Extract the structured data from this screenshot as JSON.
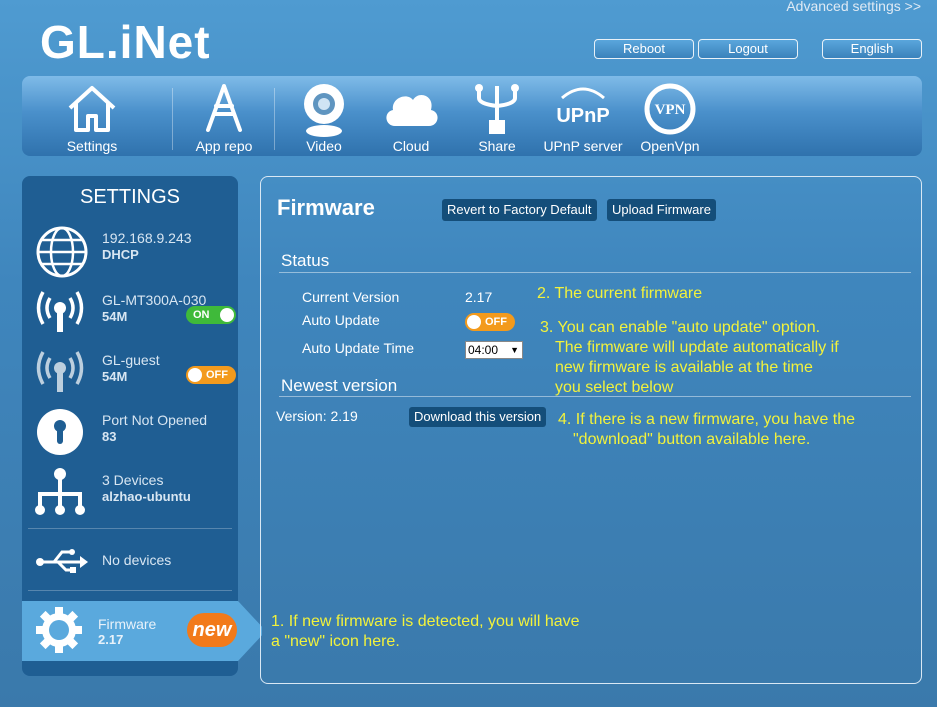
{
  "header": {
    "logo": "GL.iNet",
    "advanced_link": "Advanced settings >>",
    "reboot": "Reboot",
    "logout": "Logout",
    "language": "English"
  },
  "toolbar": {
    "items": [
      {
        "label": "Settings",
        "icon": "house-icon"
      },
      {
        "label": "App repo",
        "icon": "app-repo-icon"
      },
      {
        "label": "Video",
        "icon": "webcam-icon"
      },
      {
        "label": "Cloud",
        "icon": "cloud-icon"
      },
      {
        "label": "Share",
        "icon": "usb-share-icon"
      },
      {
        "label": "UPnP server",
        "icon": "upnp-icon"
      },
      {
        "label": "OpenVpn",
        "icon": "vpn-icon"
      }
    ]
  },
  "sidebar": {
    "title": "SETTINGS",
    "wan": {
      "line1": "192.168.9.243",
      "line2": "DHCP"
    },
    "wifi": {
      "line1": "GL-MT300A-030",
      "line2": "54M",
      "toggle": "ON"
    },
    "guest": {
      "line1": "GL-guest",
      "line2": "54M",
      "toggle": "OFF"
    },
    "port": {
      "line1": "Port Not Opened",
      "line2": "83"
    },
    "devices": {
      "line1": "3 Devices",
      "line2": "alzhao-ubuntu"
    },
    "usb": {
      "line1": "No devices"
    },
    "firmware": {
      "line1": "Firmware",
      "line2": "2.17",
      "badge": "new"
    }
  },
  "main": {
    "title": "Firmware",
    "revert_button": "Revert to Factory Default",
    "upload_button": "Upload Firmware",
    "status_heading": "Status",
    "current_version_label": "Current Version",
    "current_version_value": "2.17",
    "auto_update_label": "Auto Update",
    "auto_update_toggle": "OFF",
    "auto_update_time_label": "Auto Update Time",
    "auto_update_time_value": "04:00",
    "newest_heading": "Newest version",
    "newest_version_text": "Version: 2.19",
    "download_button": "Download this version"
  },
  "annotations": {
    "note1_line1": "1. If new firmware is detected, you will have",
    "note1_line2": "a \"new\" icon here.",
    "note2": "2. The current firmware",
    "note3_line1": "3. You can enable \"auto update\" option.",
    "note3_line2": "The firmware will update automatically if",
    "note3_line3": "new firmware is available at the time",
    "note3_line4": "you select below",
    "note4_line1": "4. If there is a new firmware, you have the",
    "note4_line2": "\"download\" button available here."
  },
  "colors": {
    "toggle_on": "#3fba3a",
    "toggle_off": "#f39a1c",
    "annotation": "#f2f23c",
    "new_badge": "#f27a1a"
  }
}
